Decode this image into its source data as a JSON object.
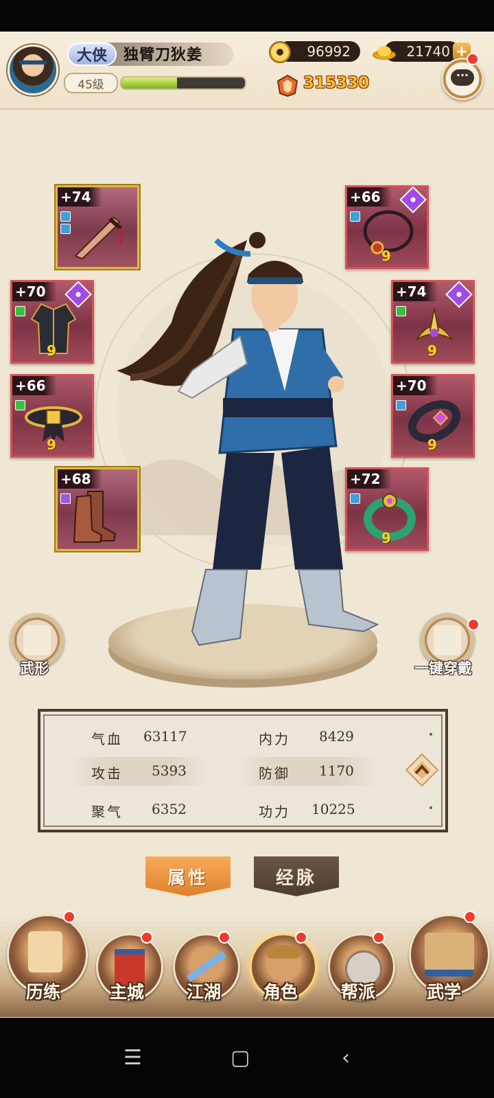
{
  "header": {
    "rank_title": "大侠",
    "player_name": "独臂刀狄姜",
    "level": "45级",
    "exp_fraction": 0.45,
    "coins": "96992",
    "gold_ingots": "21740",
    "add_label": "+",
    "combat_power": "315330",
    "chat_icon": "chat-bubble-icon"
  },
  "equipment": [
    {
      "bonus": "+74",
      "slot": "weapon-dagger",
      "frame": "gold",
      "gems": [
        "blue",
        "blue"
      ],
      "tier": ""
    },
    {
      "bonus": "+66",
      "slot": "necklace",
      "frame": "red",
      "gems": [
        "blue"
      ],
      "tier": "9",
      "rare": true
    },
    {
      "bonus": "+70",
      "slot": "robe",
      "frame": "red",
      "gems": [
        "green"
      ],
      "tier": "9",
      "rare": true
    },
    {
      "bonus": "+74",
      "slot": "hair-crown",
      "frame": "red",
      "gems": [
        "green"
      ],
      "tier": "9",
      "rare": true
    },
    {
      "bonus": "+66",
      "slot": "belt",
      "frame": "red",
      "gems": [
        "green"
      ],
      "tier": "9",
      "rare": false
    },
    {
      "bonus": "+70",
      "slot": "bracelet",
      "frame": "red",
      "gems": [
        "blue"
      ],
      "tier": "9",
      "rare": false
    },
    {
      "bonus": "+68",
      "slot": "boots",
      "frame": "gold",
      "gems": [
        "purple"
      ],
      "tier": "",
      "rare": false
    },
    {
      "bonus": "+72",
      "slot": "jade-ring",
      "frame": "red",
      "gems": [
        "blue"
      ],
      "tier": "9",
      "rare": false
    }
  ],
  "actions": {
    "appearance": "武形",
    "auto_equip": "一键穿戴"
  },
  "stats": [
    {
      "label": "气血",
      "value": "63117"
    },
    {
      "label": "内力",
      "value": "8429"
    },
    {
      "label": "攻击",
      "value": "5393"
    },
    {
      "label": "防御",
      "value": "1170"
    },
    {
      "label": "聚气",
      "value": "6352"
    },
    {
      "label": "功力",
      "value": "10225"
    }
  ],
  "tabs": {
    "attributes": "属性",
    "meridians": "经脉"
  },
  "nav": [
    {
      "label": "历练",
      "icon": "training-scroll-icon"
    },
    {
      "label": "主城",
      "icon": "main-city-gate-icon"
    },
    {
      "label": "江湖",
      "icon": "jianghu-sword-icon"
    },
    {
      "label": "角色",
      "icon": "character-portrait-icon"
    },
    {
      "label": "帮派",
      "icon": "guild-emblem-icon"
    },
    {
      "label": "武学",
      "icon": "martial-arts-books-icon"
    }
  ],
  "colors": {
    "accent": "#e1802c",
    "slot_red": "#d94f55",
    "slot_gold": "#e2b93b",
    "power_text": "#ffbd2e",
    "notification": "#ee3b2b"
  }
}
